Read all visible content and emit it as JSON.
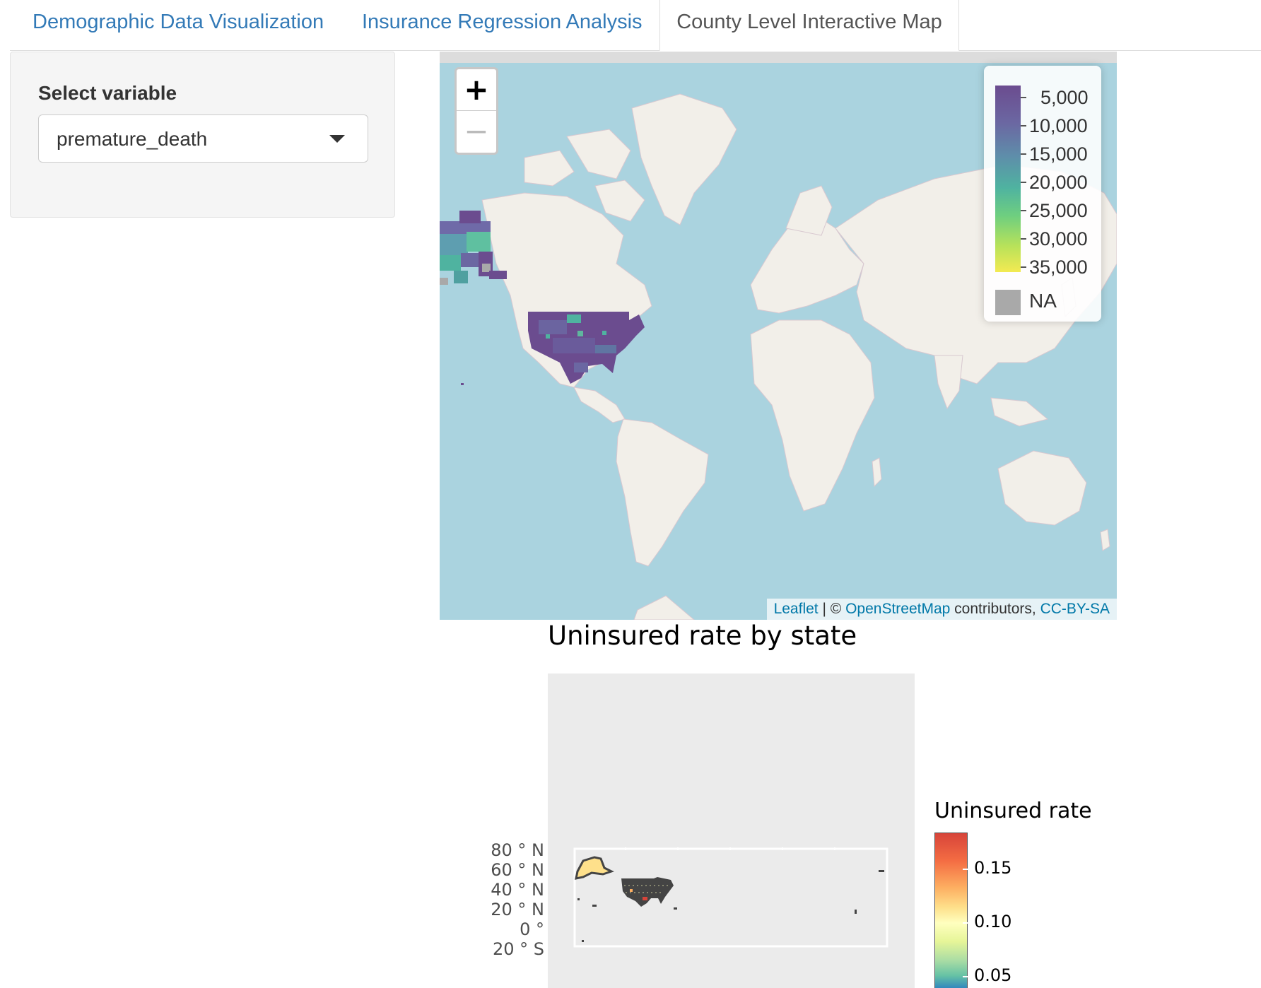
{
  "tabs": [
    {
      "label": "Demographic Data Visualization",
      "active": false
    },
    {
      "label": "Insurance Regression Analysis",
      "active": false
    },
    {
      "label": "County Level Interactive Map",
      "active": true
    }
  ],
  "sidebar": {
    "select_label": "Select variable",
    "select_value": "premature_death"
  },
  "map": {
    "zoom_in": "+",
    "zoom_out": "−",
    "legend": {
      "ticks": [
        "5,000",
        "10,000",
        "15,000",
        "20,000",
        "25,000",
        "30,000",
        "35,000"
      ],
      "na_label": "NA",
      "palette": [
        "#6b4c8f",
        "#5e8eaa",
        "#4fb3a0",
        "#b8e25a",
        "#f3ea52"
      ],
      "na_color": "#a9a9a9"
    },
    "attribution": {
      "leaflet": "Leaflet",
      "sep": " | © ",
      "osm": "OpenStreetMap",
      "contrib": " contributors, ",
      "license": "CC-BY-SA"
    }
  },
  "plot": {
    "title": "Uninsured rate by state",
    "y_ticks": [
      "80 ° N",
      "60 ° N",
      "40 ° N",
      "20 ° N",
      "0 °",
      "20 ° S"
    ],
    "colorbar": {
      "title": "Uninsured rate",
      "ticks": [
        "0.15",
        "0.10",
        "0.05"
      ]
    }
  }
}
